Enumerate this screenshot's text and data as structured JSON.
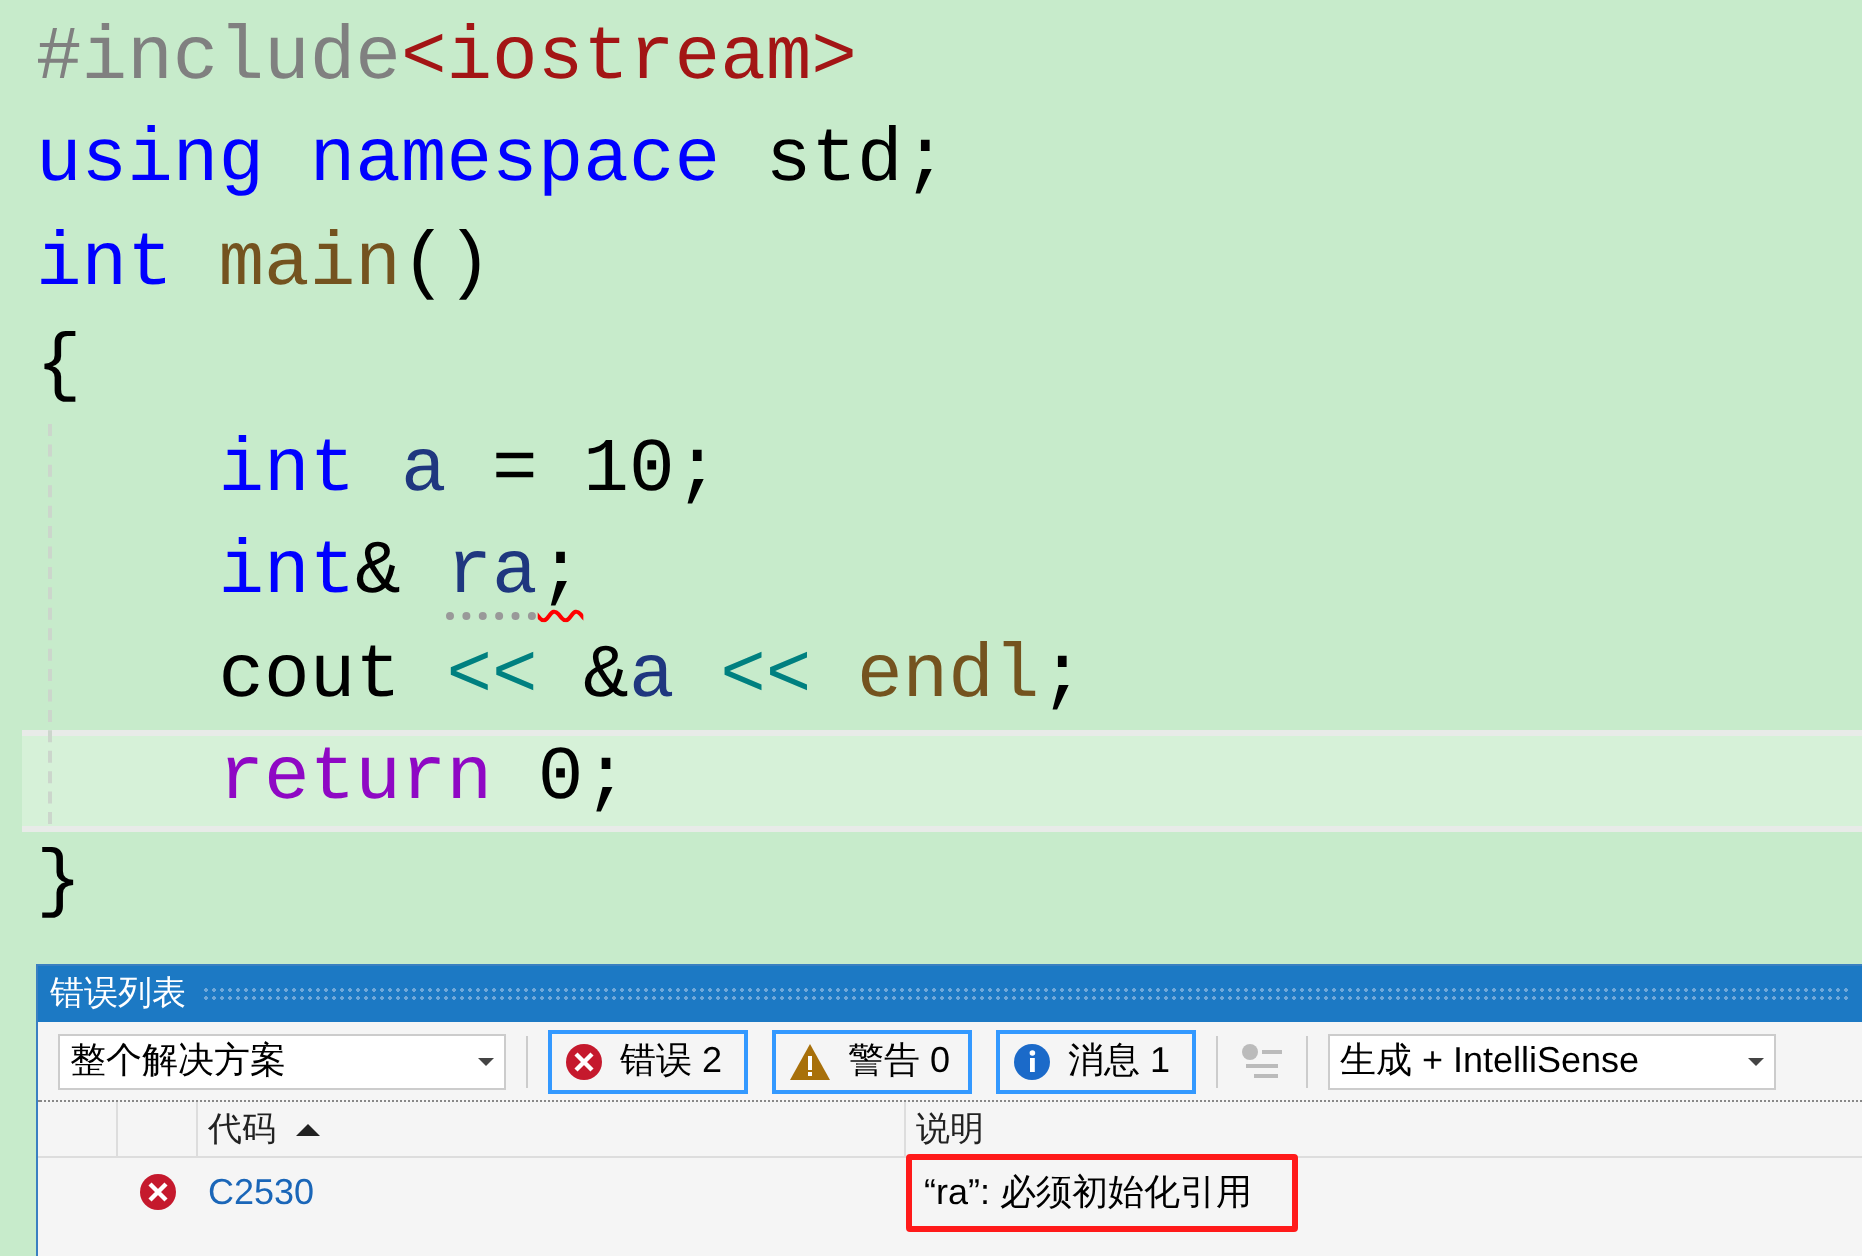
{
  "editor": {
    "lines": [
      {
        "current": false,
        "tokens": [
          {
            "kind": "macro",
            "text": "#include"
          },
          {
            "kind": "string",
            "text": "<iostream>"
          }
        ]
      },
      {
        "current": false,
        "tokens": [
          {
            "kind": "keyword",
            "text": "using "
          },
          {
            "kind": "keyword",
            "text": "namespace"
          },
          {
            "kind": "plain",
            "text": " std;"
          }
        ]
      },
      {
        "current": false,
        "tokens": [
          {
            "kind": "keyword",
            "text": "int "
          },
          {
            "kind": "function",
            "text": "main"
          },
          {
            "kind": "plain",
            "text": "()"
          }
        ]
      },
      {
        "current": false,
        "tokens": [
          {
            "kind": "plain",
            "text": "{"
          }
        ]
      },
      {
        "current": false,
        "tokens": [
          {
            "kind": "keyword",
            "text": "    int "
          },
          {
            "kind": "variable",
            "text": "a"
          },
          {
            "kind": "plain",
            "text": " = 10;"
          }
        ]
      },
      {
        "current": false,
        "tokens": [
          {
            "kind": "keyword",
            "text": "    int"
          },
          {
            "kind": "plain",
            "text": "& "
          },
          {
            "kind": "variable",
            "text": "ra",
            "hint": true
          },
          {
            "kind": "plain",
            "text": ";",
            "error": true
          }
        ]
      },
      {
        "current": false,
        "tokens": [
          {
            "kind": "plain",
            "text": "    cout "
          },
          {
            "kind": "operator",
            "text": "<< "
          },
          {
            "kind": "plain",
            "text": "&"
          },
          {
            "kind": "variable",
            "text": "a "
          },
          {
            "kind": "operator",
            "text": "<< "
          },
          {
            "kind": "function",
            "text": "endl"
          },
          {
            "kind": "plain",
            "text": ";"
          }
        ]
      },
      {
        "current": true,
        "tokens": [
          {
            "kind": "control",
            "text": "    return"
          },
          {
            "kind": "plain",
            "text": " 0;"
          }
        ]
      },
      {
        "current": false,
        "tokens": [
          {
            "kind": "plain",
            "text": "}"
          }
        ]
      }
    ]
  },
  "error_list": {
    "title": "错误列表",
    "scope": "整个解决方案",
    "filters": [
      {
        "kind": "error",
        "label": "错误 2",
        "selected": true
      },
      {
        "kind": "warning",
        "label": "警告 0",
        "selected": true
      },
      {
        "kind": "info",
        "label": "消息 1",
        "selected": true
      }
    ],
    "source": "生成 + IntelliSense",
    "columns": [
      "代码",
      "说明"
    ],
    "rows": [
      {
        "kind": "error",
        "code": "C2530",
        "description": "“ra”: 必须初始化引用",
        "highlighted": true
      }
    ]
  }
}
